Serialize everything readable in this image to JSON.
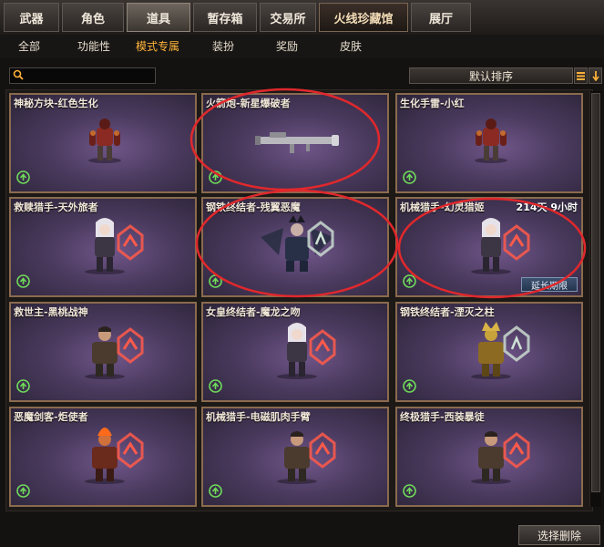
{
  "top_tabs": [
    {
      "label": "武器"
    },
    {
      "label": "角色"
    },
    {
      "label": "道具"
    },
    {
      "label": "暂存箱"
    },
    {
      "label": "交易所"
    },
    {
      "label": "火线珍藏馆"
    },
    {
      "label": "展厅"
    }
  ],
  "active_top_tab": "道具",
  "sub_tabs": [
    {
      "label": "全部"
    },
    {
      "label": "功能性"
    },
    {
      "label": "模式专属"
    },
    {
      "label": "装扮"
    },
    {
      "label": "奖励"
    },
    {
      "label": "皮肤"
    }
  ],
  "active_sub_tab": "模式专属",
  "search": {
    "value": "",
    "placeholder": ""
  },
  "sort": {
    "label": "默认排序",
    "list_icon": "list-icon",
    "order_icon": "sort-arrow-icon"
  },
  "items": [
    {
      "title": "神秘方块-红色生化",
      "type": "mutant"
    },
    {
      "title": "火箭炮-新星爆破者",
      "type": "rocket-launcher"
    },
    {
      "title": "生化手雷-小红",
      "type": "mutant"
    },
    {
      "title": "救赎猎手-天外旅者",
      "type": "female-character"
    },
    {
      "title": "钢铁终结者-残翼恶魔",
      "type": "demon-character"
    },
    {
      "title": "机械猎手-幻灵猎姬",
      "type": "female-character",
      "timer": "214天 9小时",
      "action": "延长期限"
    },
    {
      "title": "救世主-黑桃战神",
      "type": "male-character"
    },
    {
      "title": "女皇终结者-魔龙之吻",
      "type": "female-character"
    },
    {
      "title": "钢铁终结者-湮灭之柱",
      "type": "golden-character"
    },
    {
      "title": "恶魔剑客-炬使者",
      "type": "flame-character"
    },
    {
      "title": "机械猎手-电磁肌肉手臂",
      "type": "male-character"
    },
    {
      "title": "终极猎手-西装暴徒",
      "type": "male-character"
    }
  ],
  "bottom": {
    "select_delete": "选择删除"
  },
  "colors": {
    "accent_active": "#ffb43a",
    "card_border": "#8a6b4e",
    "highlight_circle": "#e0282c",
    "card_bg": "#4a3a5e"
  }
}
